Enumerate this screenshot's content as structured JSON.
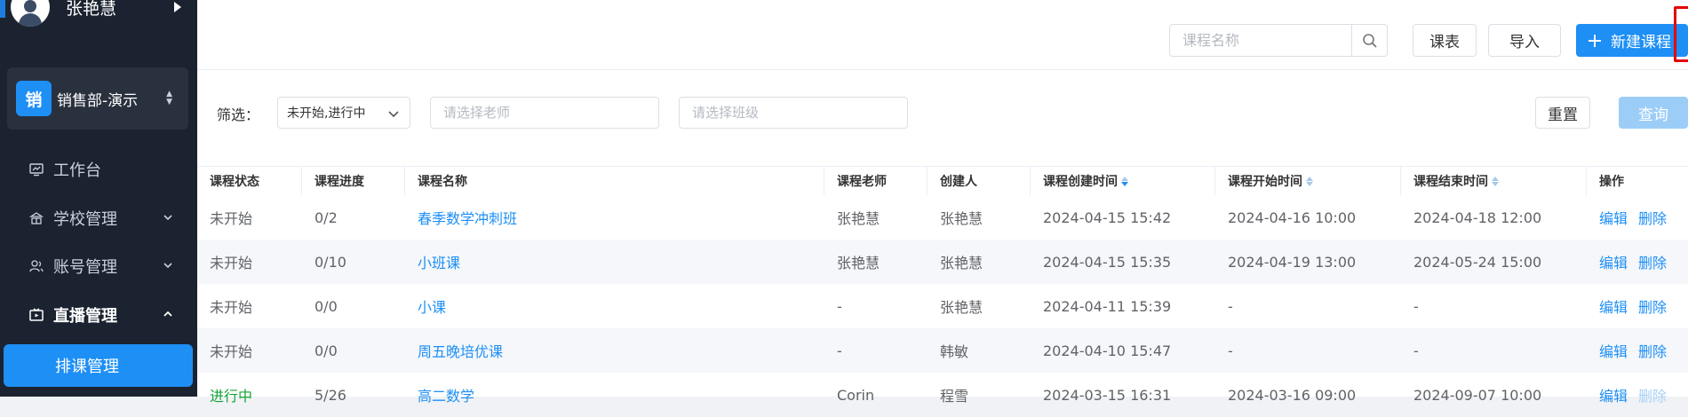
{
  "sidebar": {
    "user_name": "张艳慧",
    "org_logo": "销",
    "org_name": "销售部-演示",
    "menu": [
      {
        "label": "工作台",
        "icon": "dashboard-icon"
      },
      {
        "label": "学校管理",
        "icon": "school-icon"
      },
      {
        "label": "账号管理",
        "icon": "account-icon"
      },
      {
        "label": "直播管理",
        "icon": "live-icon"
      }
    ],
    "submenu_active": "排课管理"
  },
  "toolbar": {
    "search_placeholder": "课程名称",
    "schedule_label": "课表",
    "import_label": "导入",
    "new_course_label": "新建课程"
  },
  "filter": {
    "label": "筛选：",
    "status_value": "未开始,进行中",
    "teacher_placeholder": "请选择老师",
    "class_placeholder": "请选择班级",
    "reset_label": "重置",
    "query_label": "查询"
  },
  "table": {
    "headers": [
      "课程状态",
      "课程进度",
      "课程名称",
      "课程老师",
      "创建人",
      "课程创建时间",
      "课程开始时间",
      "课程结束时间",
      "操作"
    ],
    "op_edit": "编辑",
    "op_delete": "删除",
    "rows": [
      {
        "status": "未开始",
        "progress": "0/2",
        "name": "春季数学冲刺班",
        "teacher": "张艳慧",
        "creator": "张艳慧",
        "created": "2024-04-15 15:42",
        "start": "2024-04-16 10:00",
        "end": "2024-04-18 12:00"
      },
      {
        "status": "未开始",
        "progress": "0/10",
        "name": "小班课",
        "teacher": "张艳慧",
        "creator": "张艳慧",
        "created": "2024-04-15 15:35",
        "start": "2024-04-19 13:00",
        "end": "2024-05-24 15:00"
      },
      {
        "status": "未开始",
        "progress": "0/0",
        "name": "小课",
        "teacher": "-",
        "creator": "张艳慧",
        "created": "2024-04-11 15:39",
        "start": "-",
        "end": "-"
      },
      {
        "status": "未开始",
        "progress": "0/0",
        "name": "周五晚培优课",
        "teacher": "-",
        "creator": "韩敏",
        "created": "2024-04-10 15:47",
        "start": "-",
        "end": "-"
      },
      {
        "status": "进行中",
        "progress": "5/26",
        "name": "高二数学",
        "teacher": "Corin",
        "creator": "程雪",
        "created": "2024-03-15 16:31",
        "start": "2024-03-16 09:00",
        "end": "2024-09-07 10:00"
      }
    ]
  }
}
